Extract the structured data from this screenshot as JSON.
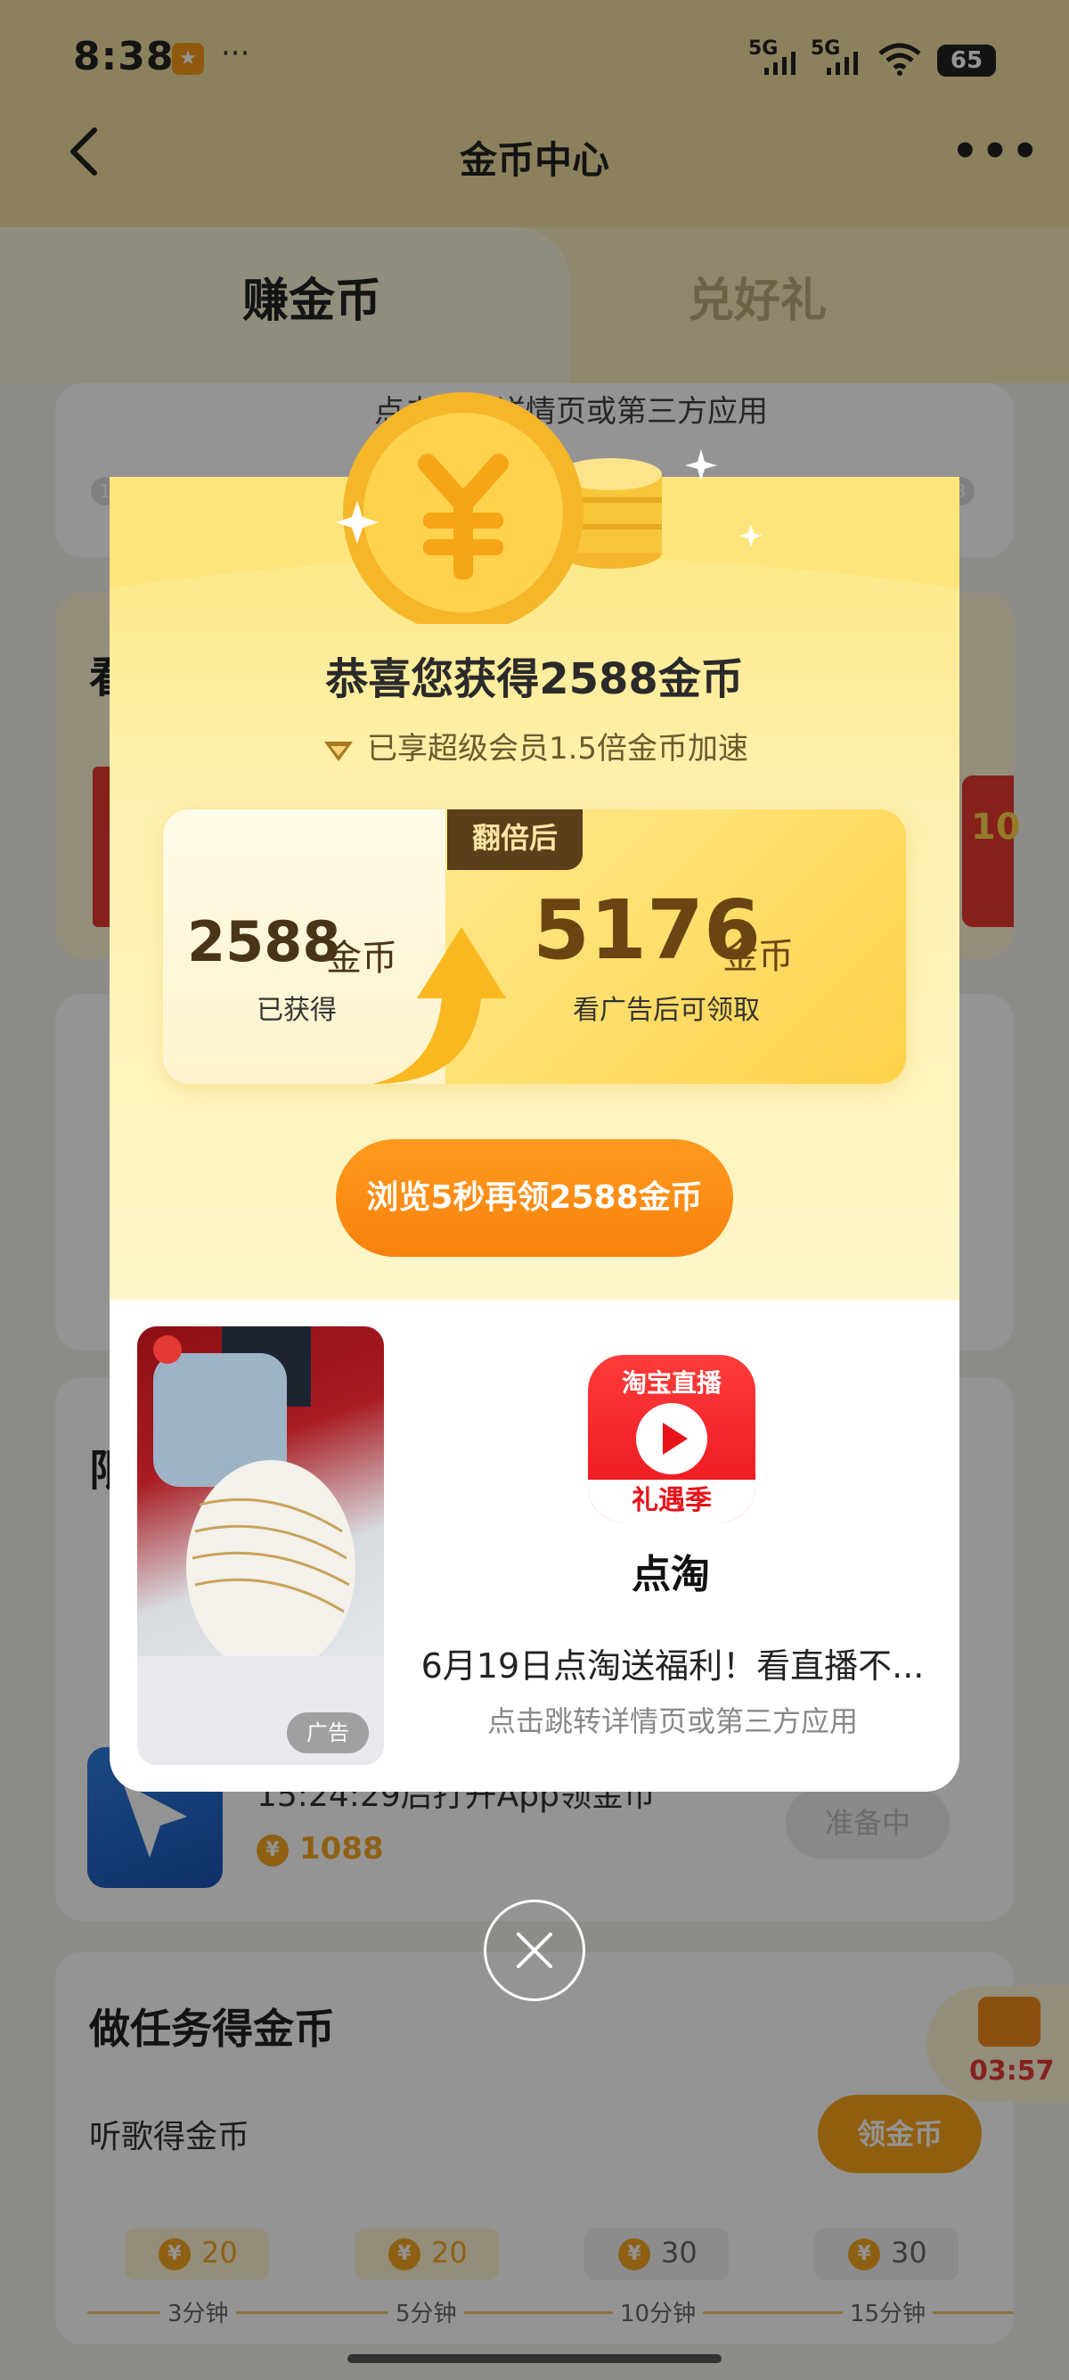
{
  "status_bar": {
    "time": "8:38",
    "more": "···",
    "signal_1": "5G",
    "signal_2": "5G",
    "battery": "65"
  },
  "nav": {
    "title": "金币中心",
    "more": "•••"
  },
  "tabs": [
    {
      "label": "赚金币",
      "active": true
    },
    {
      "label": "兑好礼",
      "active": false
    }
  ],
  "background": {
    "ad_hint_partial": "点击跳转详情页或第三方应用",
    "section_watch_partial": "看",
    "section_limit_partial": "限",
    "app_open_task": "15:24:29后打开App领金币",
    "app_open_reward": "1088",
    "app_open_button": "准备中",
    "red_badge_partial": "10",
    "tasks_title": "做任务得金币",
    "music_task": "听歌得金币",
    "claim_button": "领金币",
    "treasure_timer": "03:57",
    "steps": [
      {
        "coins": "20",
        "time": "3分钟"
      },
      {
        "coins": "20",
        "time": "5分钟"
      },
      {
        "coins": "30",
        "time": "10分钟"
      },
      {
        "coins": "30",
        "time": "15分钟"
      }
    ],
    "coin_symbol": "¥",
    "step_1": "1",
    "step_3": "3"
  },
  "popup": {
    "title": "恭喜您获得2588金币",
    "vip_text": "已享超级会员1.5倍金币加速",
    "double_badge": "翻倍后",
    "earned_amount": "2588",
    "earned_unit": "金币",
    "earned_label": "已获得",
    "doubled_amount": "5176",
    "doubled_unit": "金币",
    "doubled_label": "看广告后可领取",
    "cta": "浏览5秒再领2588金币",
    "ad": {
      "tag": "广告",
      "app_icon_top": "淘宝直播",
      "app_icon_bottom": "礼遇季",
      "app_name": "点淘",
      "description": "6月19日点淘送福利！看直播不...",
      "hint": "点击跳转详情页或第三方应用"
    }
  }
}
